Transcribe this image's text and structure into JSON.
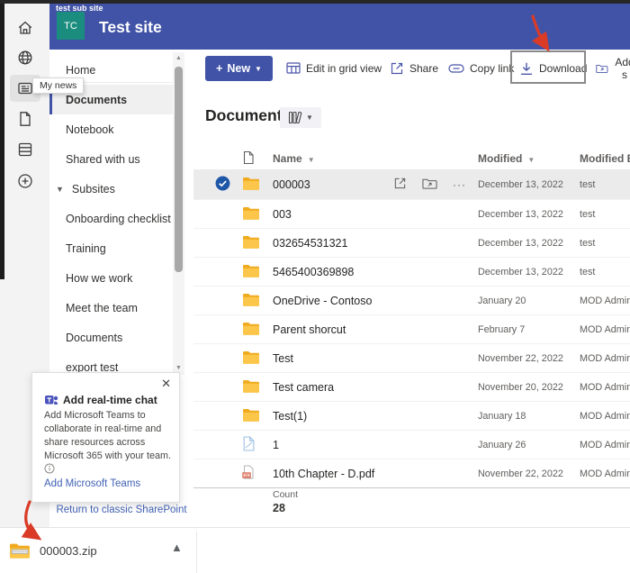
{
  "colors": {
    "accent": "#4153a7",
    "logo_teal": "#1b8d7f",
    "annotation_red": "#d93b27",
    "link_blue": "#4262b5"
  },
  "app_bar": {
    "tooltip": "My news",
    "icons": [
      "home-icon",
      "globe-icon",
      "news-icon",
      "file-icon",
      "lists-icon",
      "add-icon"
    ]
  },
  "header": {
    "parent_site": "test sub site",
    "logo_text": "TC",
    "title": "Test site"
  },
  "nav": {
    "items": [
      {
        "label": "Home"
      },
      {
        "label": "Documents",
        "selected": true
      },
      {
        "label": "Notebook"
      },
      {
        "label": "Shared with us"
      },
      {
        "label": "Subsites",
        "chevron": true
      },
      {
        "label": "Onboarding checklist"
      },
      {
        "label": "Training"
      },
      {
        "label": "How we work"
      },
      {
        "label": "Meet the team"
      },
      {
        "label": "Documents"
      },
      {
        "label": "export test",
        "clipped": true
      }
    ],
    "return_link": "Return to classic SharePoint"
  },
  "teams_card": {
    "title": "Add real-time chat",
    "body": "Add Microsoft Teams to collaborate in real-time and share resources across Microsoft 365 with your team.",
    "link": "Add Microsoft Teams"
  },
  "toolbar": {
    "new_label": "New",
    "commands": [
      {
        "label": "Edit in grid view"
      },
      {
        "label": "Share"
      },
      {
        "label": "Copy link"
      },
      {
        "label": "Download",
        "boxed": true
      },
      {
        "label": "Add s"
      }
    ]
  },
  "library": {
    "title": "Documents"
  },
  "table": {
    "columns": {
      "name": "Name",
      "modified": "Modified",
      "modified_by": "Modified By"
    },
    "rows": [
      {
        "name": "000003",
        "type": "folder",
        "modified": "December 13, 2022",
        "modified_by": "test",
        "selected": true
      },
      {
        "name": "003",
        "type": "folder",
        "modified": "December 13, 2022",
        "modified_by": "test"
      },
      {
        "name": "032654531321",
        "type": "folder",
        "modified": "December 13, 2022",
        "modified_by": "test"
      },
      {
        "name": "5465400369898",
        "type": "folder",
        "modified": "December 13, 2022",
        "modified_by": "test"
      },
      {
        "name": "OneDrive - Contoso",
        "type": "folder",
        "modified": "January 20",
        "modified_by": "MOD Adminis"
      },
      {
        "name": "Parent shorcut",
        "type": "folder",
        "modified": "February 7",
        "modified_by": "MOD Adminis"
      },
      {
        "name": "Test",
        "type": "folder",
        "modified": "November 22, 2022",
        "modified_by": "MOD Adminis"
      },
      {
        "name": "Test camera",
        "type": "folder",
        "modified": "November 20, 2022",
        "modified_by": "MOD Adminis"
      },
      {
        "name": "Test(1)",
        "type": "folder",
        "modified": "January 18",
        "modified_by": "MOD Adminis"
      },
      {
        "name": "1",
        "type": "file",
        "modified": "January 26",
        "modified_by": "MOD Adminis"
      },
      {
        "name": "10th Chapter - D.pdf",
        "type": "pdf",
        "modified": "November 22, 2022",
        "modified_by": "MOD Adminis"
      }
    ],
    "count_label": "Count",
    "count_value": "28"
  },
  "download_shelf": {
    "filename": "000003.zip"
  }
}
